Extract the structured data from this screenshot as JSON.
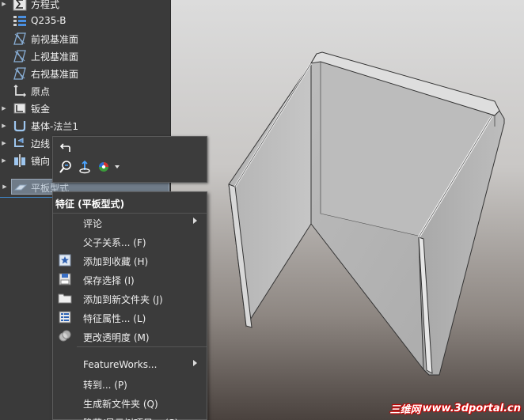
{
  "tree": {
    "items": [
      {
        "label": "方程式",
        "icon": "sigma-icon",
        "expandable": true
      },
      {
        "label": "Q235-B",
        "icon": "material-icon",
        "expandable": false
      },
      {
        "label": "前视基准面",
        "icon": "plane-icon",
        "expandable": false
      },
      {
        "label": "上视基准面",
        "icon": "plane-icon",
        "expandable": false
      },
      {
        "label": "右视基准面",
        "icon": "plane-icon",
        "expandable": false
      },
      {
        "label": "原点",
        "icon": "origin-icon",
        "expandable": false
      },
      {
        "label": "钣金",
        "icon": "sheetmetal-icon",
        "expandable": true
      },
      {
        "label": "基体-法兰1",
        "icon": "base-flange-icon",
        "expandable": true
      },
      {
        "label": "边线",
        "icon": "edge-flange-icon",
        "expandable": true
      },
      {
        "label": "镜向",
        "icon": "mirror-icon",
        "expandable": true
      }
    ],
    "selected": {
      "label": "平板型式",
      "icon": "flat-pattern-icon"
    }
  },
  "context_menu": {
    "title": "特征 (平板型式)",
    "items": [
      {
        "label": "评论",
        "icon": "",
        "submenu": true
      },
      {
        "label": "父子关系... (F)",
        "icon": "",
        "submenu": false
      },
      {
        "label": "添加到收藏 (H)",
        "icon": "favorite-star-icon",
        "submenu": false
      },
      {
        "label": "保存选择 (I)",
        "icon": "save-selection-icon",
        "submenu": false
      },
      {
        "label": "添加到新文件夹 (J)",
        "icon": "folder-icon",
        "submenu": false
      },
      {
        "label": "特征属性... (L)",
        "icon": "feature-properties-icon",
        "submenu": false
      },
      {
        "label": "更改透明度 (M)",
        "icon": "transparency-icon",
        "submenu": false
      },
      {
        "label": "FeatureWorks...",
        "icon": "",
        "submenu": true
      },
      {
        "label": "转到... (P)",
        "icon": "",
        "submenu": false
      },
      {
        "label": "生成新文件夹 (Q)",
        "icon": "",
        "submenu": false
      },
      {
        "label": "隐藏/显示树项目... (S)",
        "icon": "",
        "submenu": false
      }
    ]
  },
  "mini_toolbar": {
    "tools": [
      "rollback-icon",
      "zoom-to-selection-icon",
      "normal-to-icon",
      "appearance-icon",
      "dropdown-arrow-icon"
    ]
  },
  "watermark": {
    "cn": "三维网",
    "url": "www.3dportal.cn"
  },
  "colors": {
    "tree_bg": "#3a3a3a",
    "menu_bg": "#3b3b3b",
    "selection": "#6f7b88",
    "part_face": "#bdbdbd"
  }
}
